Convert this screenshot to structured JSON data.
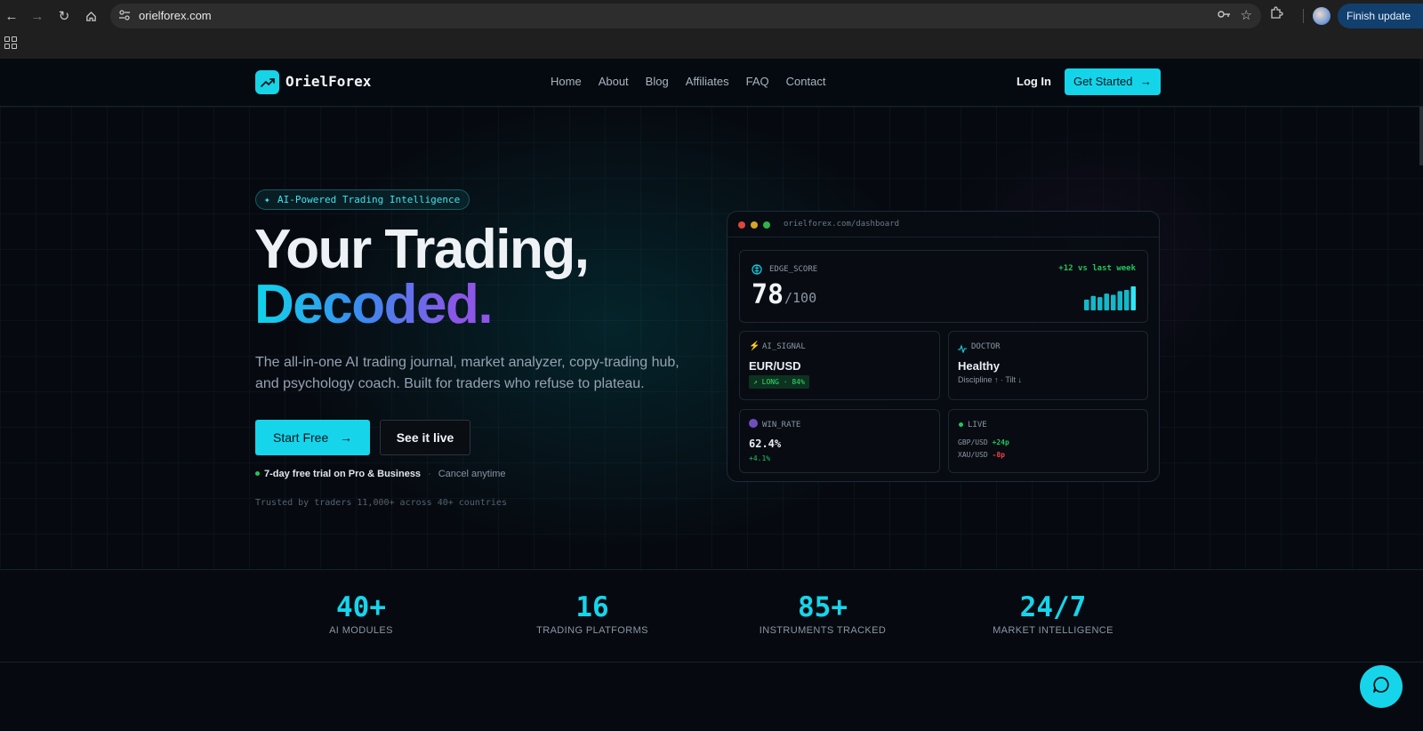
{
  "browser": {
    "url": "orielforex.com",
    "update_label": "Finish update"
  },
  "nav": {
    "brand": "OrielForex",
    "links": [
      "Home",
      "About",
      "Blog",
      "Affiliates",
      "FAQ",
      "Contact"
    ],
    "login": "Log In",
    "get_started": "Get Started"
  },
  "hero": {
    "badge": "AI-Powered Trading Intelligence",
    "title_line1": "Your Trading,",
    "title_line2": "Decoded.",
    "lead": "The all-in-one AI trading journal, market analyzer, copy-trading hub, and psychology coach. Built for traders who refuse to plateau.",
    "start_free": "Start Free",
    "see_live": "See it live",
    "trial": "7-day free trial on Pro & Business",
    "separator": "·",
    "cancel": "Cancel anytime",
    "trusted": "Trusted by traders 11,000+ across 40+ countries"
  },
  "dashboard": {
    "url": "orielforex.com/dashboard",
    "edge": {
      "label": "EDGE_SCORE",
      "score": "78",
      "of": "/100",
      "delta": "+12 vs last week",
      "bar_levels": [
        0.45,
        0.6,
        0.55,
        0.7,
        0.65,
        0.8,
        0.85,
        1.0
      ]
    },
    "signal": {
      "label": "AI_SIGNAL",
      "pair": "EUR/USD",
      "pill": "LONG · 84%"
    },
    "doctor": {
      "label": "DOCTOR",
      "status": "Healthy",
      "detail": "Discipline ↑ · Tilt ↓"
    },
    "win": {
      "label": "WIN_RATE",
      "value": "62.4%",
      "delta": "+4.1%"
    },
    "live": {
      "label": "LIVE",
      "rows": [
        {
          "pair": "GBP/USD",
          "move": "+24p"
        },
        {
          "pair": "XAU/USD",
          "move": "-8p"
        }
      ]
    }
  },
  "stats": [
    {
      "value": "40+",
      "label": "AI MODULES"
    },
    {
      "value": "16",
      "label": "TRADING PLATFORMS"
    },
    {
      "value": "85+",
      "label": "INSTRUMENTS TRACKED"
    },
    {
      "value": "24/7",
      "label": "MARKET INTELLIGENCE"
    }
  ],
  "colors": {
    "accent": "#16d5eb",
    "background": "#060a10",
    "positive": "#22c55e",
    "negative": "#ef4444",
    "gradient_end": "#8c56e6"
  }
}
